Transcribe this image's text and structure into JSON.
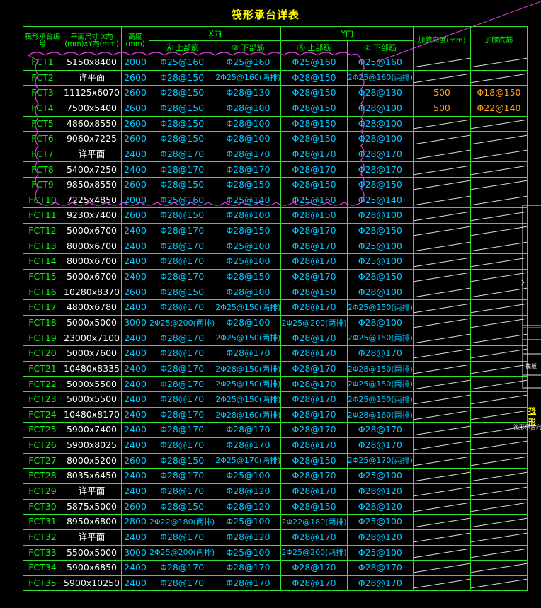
{
  "title": "筏形承台详表",
  "headers": {
    "id": "筏形承台编号",
    "size": "平面尺寸 X向(mm)xY向(mm)",
    "height": "高度(mm)",
    "x_group": "X向",
    "y_group": "Y向",
    "x_top": "Ⓐ 上部筋",
    "x_bot": "② 下部筋",
    "y_top": "Ⓐ 上部筋",
    "y_bot": "② 下部筋",
    "extra_height": "加腋高度(mm)",
    "extra_bar": "加腋底筋"
  },
  "rows": [
    [
      "FCT1",
      "5150x8400",
      "2000",
      "Φ25@160",
      "Φ25@160",
      "Φ25@160",
      "Φ25@160",
      "",
      ""
    ],
    [
      "FCT2",
      "详平面",
      "2600",
      "Φ28@150",
      "2Φ25@160(两排)",
      "Φ28@150",
      "2Φ25@160(两排)",
      "",
      ""
    ],
    [
      "FCT3",
      "11125x6070",
      "2600",
      "Φ28@150",
      "Φ28@130",
      "Φ28@150",
      "Φ28@130",
      "500",
      "Φ18@150"
    ],
    [
      "FCT4",
      "7500x5400",
      "2600",
      "Φ28@150",
      "Φ28@100",
      "Φ28@150",
      "Φ28@100",
      "500",
      "Φ22@140"
    ],
    [
      "FCT5",
      "4860x8550",
      "2600",
      "Φ28@150",
      "Φ28@100",
      "Φ28@150",
      "Φ28@100",
      "",
      ""
    ],
    [
      "FCT6",
      "9060x7225",
      "2600",
      "Φ28@150",
      "Φ28@100",
      "Φ28@150",
      "Φ28@100",
      "",
      ""
    ],
    [
      "FCT7",
      "详平面",
      "2400",
      "Φ28@170",
      "Φ28@170",
      "Φ28@170",
      "Φ28@170",
      "",
      ""
    ],
    [
      "FCT8",
      "5400x7250",
      "2400",
      "Φ28@170",
      "Φ28@170",
      "Φ28@170",
      "Φ28@170",
      "",
      ""
    ],
    [
      "FCT9",
      "9850x8550",
      "2600",
      "Φ28@150",
      "Φ28@150",
      "Φ28@150",
      "Φ28@150",
      "",
      ""
    ],
    [
      "FCT10",
      "7225x4850",
      "2000",
      "Φ25@160",
      "Φ25@140",
      "Φ25@160",
      "Φ25@140",
      "",
      ""
    ],
    [
      "FCT11",
      "9230x7400",
      "2600",
      "Φ28@150",
      "Φ28@100",
      "Φ28@150",
      "Φ28@100",
      "",
      ""
    ],
    [
      "FCT12",
      "5000x6700",
      "2400",
      "Φ28@170",
      "Φ28@150",
      "Φ28@170",
      "Φ28@150",
      "",
      ""
    ],
    [
      "FCT13",
      "8000x6700",
      "2400",
      "Φ28@170",
      "Φ25@100",
      "Φ28@170",
      "Φ25@100",
      "",
      ""
    ],
    [
      "FCT14",
      "8000x6700",
      "2400",
      "Φ28@170",
      "Φ25@100",
      "Φ28@170",
      "Φ25@100",
      "",
      ""
    ],
    [
      "FCT15",
      "5000x6700",
      "2400",
      "Φ28@170",
      "Φ28@150",
      "Φ28@170",
      "Φ28@150",
      "",
      ""
    ],
    [
      "FCT16",
      "10280x8370",
      "2600",
      "Φ28@150",
      "Φ28@100",
      "Φ28@150",
      "Φ28@100",
      "",
      ""
    ],
    [
      "FCT17",
      "4800x6780",
      "2400",
      "Φ28@170",
      "2Φ25@150(两排)",
      "Φ28@170",
      "2Φ25@150(两排)",
      "",
      ""
    ],
    [
      "FCT18",
      "5000x5000",
      "3000",
      "2Φ25@200(两排)",
      "Φ28@100",
      "2Φ25@200(两排)",
      "Φ28@100",
      "",
      ""
    ],
    [
      "FCT19",
      "23000x7100",
      "2400",
      "Φ28@170",
      "2Φ25@150(两排)",
      "Φ28@170",
      "2Φ25@150(两排)",
      "",
      ""
    ],
    [
      "FCT20",
      "5000x7600",
      "2400",
      "Φ28@170",
      "Φ28@170",
      "Φ28@170",
      "Φ28@170",
      "",
      ""
    ],
    [
      "FCT21",
      "10480x8335",
      "2400",
      "Φ28@170",
      "2Φ28@150(两排)",
      "Φ28@170",
      "2Φ28@150(两排)",
      "",
      ""
    ],
    [
      "FCT22",
      "5000x5500",
      "2400",
      "Φ28@170",
      "2Φ25@150(两排)",
      "Φ28@170",
      "2Φ25@150(两排)",
      "",
      ""
    ],
    [
      "FCT23",
      "5000x5500",
      "2400",
      "Φ28@170",
      "2Φ25@150(两排)",
      "Φ28@170",
      "2Φ25@150(两排)",
      "",
      ""
    ],
    [
      "FCT24",
      "10480x8170",
      "2400",
      "Φ28@170",
      "2Φ28@160(两排)",
      "Φ28@170",
      "2Φ28@160(两排)",
      "",
      ""
    ],
    [
      "FCT25",
      "5900x7400",
      "2400",
      "Φ28@170",
      "Φ28@170",
      "Φ28@170",
      "Φ28@170",
      "",
      ""
    ],
    [
      "FCT26",
      "5900x8025",
      "2400",
      "Φ28@170",
      "Φ28@170",
      "Φ28@170",
      "Φ28@170",
      "",
      ""
    ],
    [
      "FCT27",
      "8000x5200",
      "2600",
      "Φ28@150",
      "2Φ25@170(两排)",
      "Φ28@150",
      "2Φ25@170(两排)",
      "",
      ""
    ],
    [
      "FCT28",
      "8035x6450",
      "2400",
      "Φ28@170",
      "Φ25@100",
      "Φ28@170",
      "Φ25@100",
      "",
      ""
    ],
    [
      "FCT29",
      "详平面",
      "2400",
      "Φ28@170",
      "Φ28@120",
      "Φ28@170",
      "Φ28@120",
      "",
      ""
    ],
    [
      "FCT30",
      "5875x5000",
      "2600",
      "Φ28@150",
      "Φ28@120",
      "Φ28@150",
      "Φ28@120",
      "",
      ""
    ],
    [
      "FCT31",
      "8950x6800",
      "2800",
      "2Φ22@180(两排)",
      "Φ25@100",
      "2Φ22@180(两排)",
      "Φ25@100",
      "",
      ""
    ],
    [
      "FCT32",
      "详平面",
      "2400",
      "Φ28@170",
      "Φ28@120",
      "Φ28@170",
      "Φ28@120",
      "",
      ""
    ],
    [
      "FCT33",
      "5500x5000",
      "3000",
      "2Φ25@200(两排)",
      "Φ25@100",
      "2Φ25@200(两排)",
      "Φ25@100",
      "",
      ""
    ],
    [
      "FCT34",
      "5900x6850",
      "2400",
      "Φ28@170",
      "Φ28@170",
      "Φ28@170",
      "Φ28@170",
      "",
      ""
    ],
    [
      "FCT35",
      "5900x10250",
      "2400",
      "Φ28@170",
      "Φ28@170",
      "Φ28@170",
      "Φ28@170",
      "",
      ""
    ]
  ],
  "side_fragments": {
    "label_a": "筏形",
    "label_b": "筏形承台向量",
    "label_c": "筏板"
  },
  "colors": {
    "grid": "#33e033",
    "id_text": "#00ff00",
    "height_text": "#00c8ff",
    "rebar_text": "#00c8ff",
    "extra_text": "#ffa01a",
    "cloud": "#e040e0",
    "title": "#ffff00"
  }
}
